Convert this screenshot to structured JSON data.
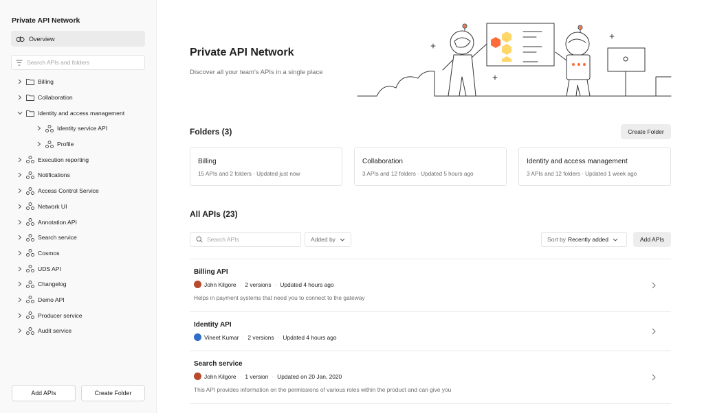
{
  "sidebar": {
    "title": "Private API Network",
    "overview_label": "Overview",
    "search_placeholder": "Search APIs and folders",
    "tree": [
      {
        "label": "Billing",
        "type": "folder",
        "expanded": false,
        "level": 0
      },
      {
        "label": "Collaboration",
        "type": "folder",
        "expanded": false,
        "level": 0
      },
      {
        "label": "Identity and access management",
        "type": "folder",
        "expanded": true,
        "level": 0
      },
      {
        "label": "Identity service API",
        "type": "api",
        "expanded": false,
        "level": 1
      },
      {
        "label": "Profile",
        "type": "api",
        "expanded": false,
        "level": 1
      },
      {
        "label": "Execution reporting",
        "type": "api",
        "expanded": false,
        "level": 0
      },
      {
        "label": "Notifications",
        "type": "api",
        "expanded": false,
        "level": 0
      },
      {
        "label": "Access Control Service",
        "type": "api",
        "expanded": false,
        "level": 0
      },
      {
        "label": "Network UI",
        "type": "api",
        "expanded": false,
        "level": 0
      },
      {
        "label": "Annotation API",
        "type": "api",
        "expanded": false,
        "level": 0
      },
      {
        "label": "Search service",
        "type": "api",
        "expanded": false,
        "level": 0
      },
      {
        "label": "Cosmos",
        "type": "api",
        "expanded": false,
        "level": 0
      },
      {
        "label": "UDS API",
        "type": "api",
        "expanded": false,
        "level": 0
      },
      {
        "label": "Changelog",
        "type": "api",
        "expanded": false,
        "level": 0
      },
      {
        "label": "Demo API",
        "type": "api",
        "expanded": false,
        "level": 0
      },
      {
        "label": "Producer service",
        "type": "api",
        "expanded": false,
        "level": 0
      },
      {
        "label": "Audit service",
        "type": "api",
        "expanded": false,
        "level": 0
      }
    ],
    "add_apis_label": "Add APIs",
    "create_folder_label": "Create Folder"
  },
  "hero": {
    "title": "Private API Network",
    "subtitle": "Discover all your team's APIs in a single place"
  },
  "folders": {
    "title": "Folders (3)",
    "create_label": "Create Folder",
    "items": [
      {
        "name": "Billing",
        "meta": "15 APIs and 2 folders  ·  Updated just now"
      },
      {
        "name": "Collaboration",
        "meta": "3 APIs and 12 folders  ·  Updated 5 hours ago"
      },
      {
        "name": "Identity and access management",
        "meta": "3 APIs and 12 folders  ·  Updated 1 week ago"
      }
    ]
  },
  "apis": {
    "title": "All APIs (23)",
    "search_placeholder": "Search APIs",
    "added_by_label": "Added by",
    "sort_prefix": "Sort by",
    "sort_value": "Recently added",
    "add_label": "Add APIs",
    "items": [
      {
        "name": "Billing API",
        "author": "John Kilgore",
        "versions": "2 versions",
        "updated": "Updated 4 hours ago",
        "description": "Helps in payment systems that need you to connect to the gateway",
        "avatar_color": "#b84a2e"
      },
      {
        "name": "Identity API",
        "author": "Vineet Kumar",
        "versions": "2 versions",
        "updated": "Updated 4 hours ago",
        "description": "",
        "avatar_color": "#2f6fc9"
      },
      {
        "name": "Search service",
        "author": "John Kilgore",
        "versions": "1 version",
        "updated": "Updated on 20 Jan, 2020",
        "description": "This API provides information on the permissions of various roles within the product and can give you",
        "avatar_color": "#b84a2e"
      }
    ]
  },
  "colors": {
    "accent": "#ff6c37",
    "honey": "#ffd769",
    "sidebar_bg": "#f9f9f9"
  }
}
